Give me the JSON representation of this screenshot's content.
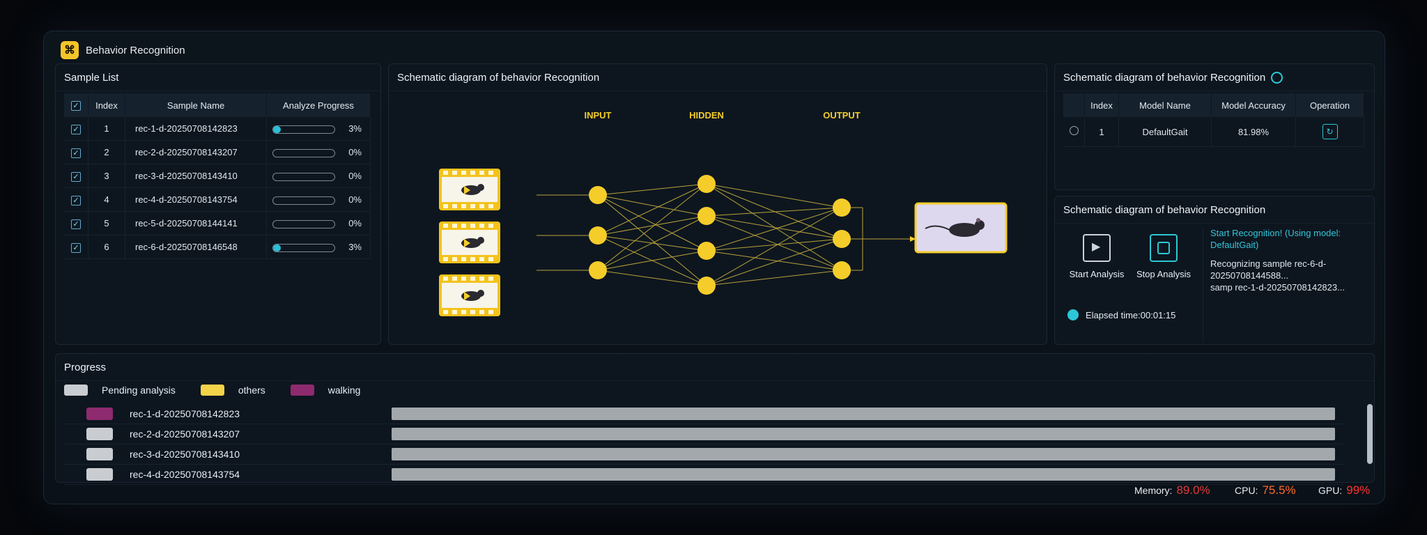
{
  "app": {
    "title": "Behavior Recognition"
  },
  "sample_list": {
    "title": "Sample List",
    "headers": {
      "index": "Index",
      "name": "Sample Name",
      "progress": "Analyze Progress"
    },
    "rows": [
      {
        "index": "1",
        "name": "rec-1-d-20250708142823",
        "progress": 3,
        "pct": "3%"
      },
      {
        "index": "2",
        "name": "rec-2-d-20250708143207",
        "progress": 0,
        "pct": "0%"
      },
      {
        "index": "3",
        "name": "rec-3-d-20250708143410",
        "progress": 0,
        "pct": "0%"
      },
      {
        "index": "4",
        "name": "rec-4-d-20250708143754",
        "progress": 0,
        "pct": "0%"
      },
      {
        "index": "5",
        "name": "rec-5-d-20250708144141",
        "progress": 0,
        "pct": "0%"
      },
      {
        "index": "6",
        "name": "rec-6-d-20250708146548",
        "progress": 3,
        "pct": "3%"
      }
    ]
  },
  "schematic": {
    "title": "Schematic diagram of behavior Recognition",
    "layers": {
      "input": "INPUT",
      "hidden": "HIDDEN",
      "output": "OUTPUT"
    },
    "colors": {
      "node": "#f5cd2a",
      "frame": "#f3c31c",
      "link": "#b9a23a"
    }
  },
  "model_panel": {
    "title": "Schematic diagram of behavior Recognition",
    "headers": {
      "index": "Index",
      "name": "Model Name",
      "accuracy": "Model Accuracy",
      "operation": "Operation"
    },
    "rows": [
      {
        "index": "1",
        "name": "DefaultGait",
        "accuracy": "81.98%"
      }
    ]
  },
  "control_panel": {
    "title": "Schematic diagram of behavior Recognition",
    "start_label": "Start Analysis",
    "stop_label": "Stop Analysis",
    "elapsed": "Elapsed time:00:01:15",
    "log": {
      "status": "Start Recognition! (Using model: DefaultGait)",
      "line1": "Recognizing sample rec-6-d-20250708144588... ",
      "line2": "samp rec-1-d-20250708142823..."
    }
  },
  "progress_panel": {
    "title": "Progress",
    "legend": [
      {
        "label": "Pending analysis",
        "color": "#c9cdd1"
      },
      {
        "label": "others",
        "color": "#f4d24a"
      },
      {
        "label": "walking",
        "color": "#8e2a6e"
      }
    ],
    "rows": [
      {
        "name": "rec-1-d-20250708142823",
        "swatch": "#8e2a6e"
      },
      {
        "name": "rec-2-d-20250708143207",
        "swatch": "#c9cdd1"
      },
      {
        "name": "rec-3-d-20250708143410",
        "swatch": "#c9cdd1"
      },
      {
        "name": "rec-4-d-20250708143754",
        "swatch": "#c9cdd1"
      }
    ]
  },
  "status_bar": {
    "memory_label": "Memory:",
    "memory_value": "89.0%",
    "cpu_label": "CPU:",
    "cpu_value": "75.5%",
    "gpu_label": "GPU:",
    "gpu_value": "99%",
    "colors": {
      "memory": "#e03a3a",
      "cpu": "#ff6a2a",
      "gpu": "#ff3030"
    }
  }
}
